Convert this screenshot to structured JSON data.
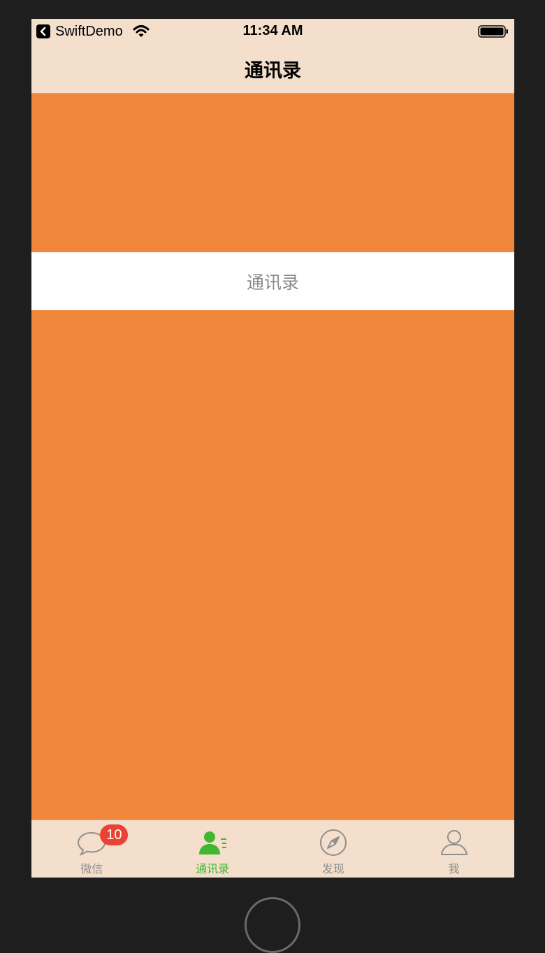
{
  "status_bar": {
    "back_app_label": "SwiftDemo",
    "time": "11:34 AM",
    "icons": [
      "back-chevron-icon",
      "wifi-icon",
      "battery-icon"
    ]
  },
  "nav": {
    "title": "通讯录"
  },
  "content": {
    "label": "通讯录"
  },
  "tab_bar": {
    "tabs": [
      {
        "label": "微信",
        "icon": "chat-bubble-icon",
        "badge": "10",
        "active": false
      },
      {
        "label": "通讯录",
        "icon": "contacts-icon",
        "active": true
      },
      {
        "label": "发现",
        "icon": "compass-icon",
        "active": false
      },
      {
        "label": "我",
        "icon": "person-icon",
        "active": false
      }
    ]
  },
  "colors": {
    "background": "#f0873a",
    "bar_background": "#f3dfcb",
    "active_tab": "#3fb72e",
    "inactive_tab": "#8f8f8f",
    "badge": "#ea4335",
    "frame": "#1e1e1e"
  }
}
